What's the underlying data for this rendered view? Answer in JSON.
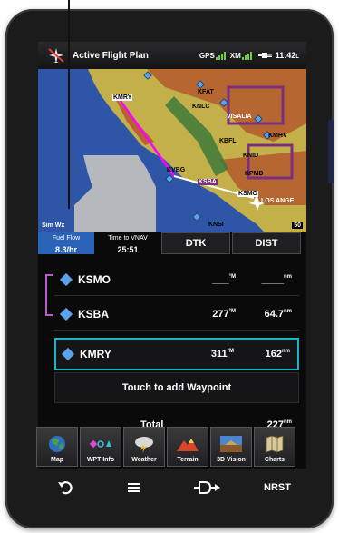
{
  "status_bar": {
    "title": "Active Flight Plan",
    "gps_label": "GPS",
    "xm_label": "XM",
    "time": "11:42",
    "time_suffix": "L"
  },
  "map": {
    "labels": [
      "KMRY",
      "KFAT",
      "KNLC",
      "VISALIA",
      "KBFL",
      "KMHV",
      "KNID",
      "KVBG",
      "KSBA",
      "KPMD",
      "KSMO",
      "LOS ANGE",
      "KNSI"
    ],
    "sim_wx": "Sim Wx",
    "range": "50",
    "colors": {
      "ocean": "#2f55a6",
      "land": "#c4b04a",
      "terrain_red": "#b24d2a",
      "restricted": "#7a2f7f",
      "route": "#ff00ff"
    }
  },
  "data_bar": {
    "fuel_flow_label": "Fuel Flow",
    "fuel_flow_value": "8.3/hr",
    "vnav_label": "Time to VNAV",
    "vnav_value": "25:51",
    "dtk_button": "DTK",
    "dist_button": "DIST"
  },
  "waypoints": [
    {
      "name": "KSMO",
      "dtk": "___",
      "dtk_unit": "°M",
      "dist": "____",
      "dist_unit": "nm",
      "active": false
    },
    {
      "name": "KSBA",
      "dtk": "277",
      "dtk_unit": "°M",
      "dist": "64.7",
      "dist_unit": "nm",
      "active": false
    },
    {
      "name": "KMRY",
      "dtk": "311",
      "dtk_unit": "°M",
      "dist": "162",
      "dist_unit": "nm",
      "active": true
    }
  ],
  "touch_add": "Touch to add Waypoint",
  "total": {
    "label": "Total",
    "value": "227",
    "unit": "nm"
  },
  "tiles": [
    {
      "label": "Map",
      "icon": "map-icon"
    },
    {
      "label": "WPT Info",
      "icon": "waypoint-info-icon"
    },
    {
      "label": "Weather",
      "icon": "weather-icon"
    },
    {
      "label": "Terrain",
      "icon": "terrain-icon"
    },
    {
      "label": "3D Vision",
      "icon": "3d-vision-icon"
    },
    {
      "label": "Charts",
      "icon": "charts-icon"
    }
  ],
  "nav": {
    "back_icon": "back-arrow-icon",
    "menu_icon": "menu-icon",
    "direct_to_icon": "direct-to-icon",
    "nrst_label": "NRST"
  }
}
